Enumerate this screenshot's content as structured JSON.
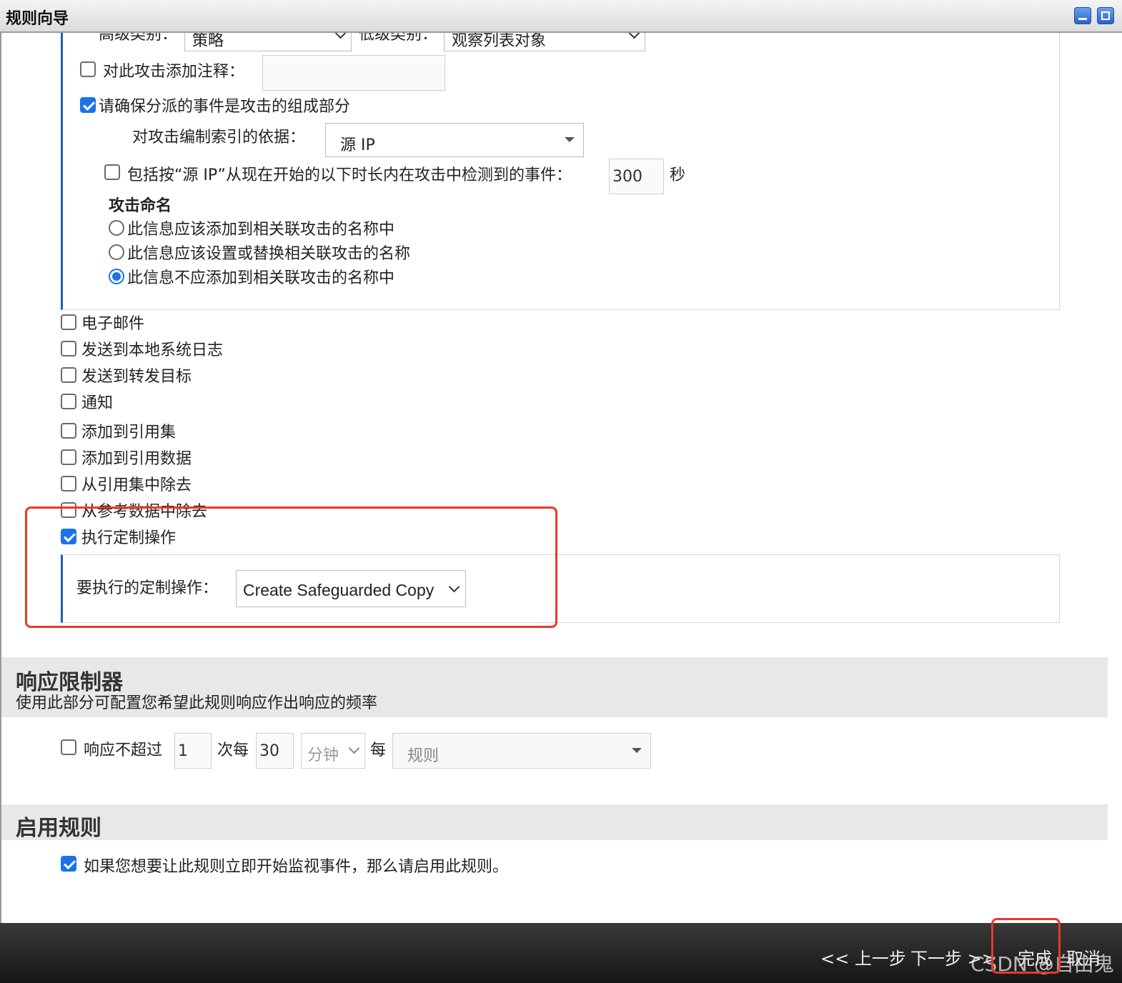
{
  "window": {
    "title": "规则向导"
  },
  "top_row": {
    "high_category_label": "高级类别：",
    "high_category_value": "策略",
    "low_category_label": "低级类别：",
    "low_category_value": "观察列表对象"
  },
  "annotate": {
    "label": "对此攻击添加注释：",
    "value": "",
    "checked": false
  },
  "ensure_part": {
    "label": "请确保分派的事件是攻击的组成部分",
    "checked": true
  },
  "index_by": {
    "label": "对攻击编制索引的依据：",
    "value": "源 IP"
  },
  "include_events": {
    "label": "包括按“源 IP”从现在开始的以下时长内在攻击中检测到的事件：",
    "value": "300",
    "unit": "秒",
    "checked": false
  },
  "naming": {
    "heading": "攻击命名",
    "options": [
      {
        "label": "此信息应该添加到相关联攻击的名称中",
        "selected": false
      },
      {
        "label": "此信息应该设置或替换相关联攻击的名称",
        "selected": false
      },
      {
        "label": "此信息不应添加到相关联攻击的名称中",
        "selected": true
      }
    ]
  },
  "actions": [
    {
      "label": "电子邮件",
      "checked": false
    },
    {
      "label": "发送到本地系统日志",
      "checked": false
    },
    {
      "label": "发送到转发目标",
      "checked": false
    },
    {
      "label": "通知",
      "checked": false
    },
    {
      "label": "添加到引用集",
      "checked": false
    },
    {
      "label": "添加到引用数据",
      "checked": false
    },
    {
      "label": "从引用集中除去",
      "checked": false
    },
    {
      "label": "从参考数据中除去",
      "checked": false
    },
    {
      "label": "执行定制操作",
      "checked": true
    }
  ],
  "custom_action": {
    "label": "要执行的定制操作：",
    "value": "Create Safeguarded Copy"
  },
  "limiter": {
    "title": "响应限制器",
    "description": "使用此部分可配置您希望此规则响应作出响应的频率",
    "label": "响应不超过",
    "count": "1",
    "per_label": "次每",
    "period": "30",
    "unit": "分钟",
    "each_label": "每",
    "scope": "规则",
    "checked": false
  },
  "enable": {
    "title": "启用规则",
    "label": "如果您想要让此规则立即开始监视事件，那么请启用此规则。",
    "checked": true
  },
  "footer": {
    "prev": "<< 上一步",
    "next": "下一步 >>",
    "finish": "完成",
    "cancel": "取消",
    "watermark": "CSDN @自由鬼"
  },
  "colors": {
    "accent": "#1a73e8",
    "highlight": "#e8392d",
    "panel_border": "#1f5fae"
  }
}
